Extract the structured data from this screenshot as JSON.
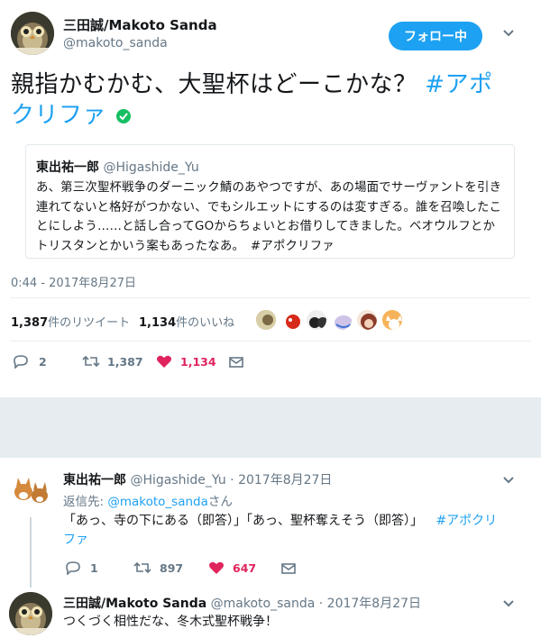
{
  "main_tweet": {
    "display_name": "三田誠/Makoto Sanda",
    "handle": "@makoto_sanda",
    "follow_label": "フォロー中",
    "text_line1": "親指かむかむ、大聖杯はどーこかな？",
    "hashtag_part1": "#アポ",
    "hashtag_part2": "クリファ",
    "quote": {
      "display_name": "東出祐一郎",
      "handle": "@Higashide_Yu",
      "lines": [
        "あ、第三次聖杯戦争のダーニック鯖のあやつですが、あの場面でサーヴァントを引き",
        "連れてないと格好がつかない、でもシルエットにするのは変すぎる。誰を召喚したこ",
        "とにしよう……と話し合ってGOからちょいとお借りしてきました。ベオウルフとか",
        "トリスタンとかいう案もあったなあ。　#アポクリファ"
      ]
    },
    "timestamp": "0:44 - 2017年8月27日",
    "retweets_count": "1,387",
    "retweets_label": "件のリツイート",
    "likes_count": "1,134",
    "likes_label": "件のいいね",
    "actions": {
      "replies": "2",
      "retweets": "1,387",
      "likes": "1,134"
    }
  },
  "reply1": {
    "display_name": "東出祐一郎",
    "handle": "@Higashide_Yu",
    "date": "· 2017年8月27日",
    "reply_to_prefix": "返信先: ",
    "reply_to_handle": "@makoto_sanda",
    "reply_to_suffix": "さん",
    "text_line1": "「あっ、寺の下にある（即答）」「あっ、聖杯奪えそう（即答）」",
    "hashtag_part1": "#アポクリ",
    "hashtag_part2": "ファ",
    "actions": {
      "replies": "1",
      "retweets": "897",
      "likes": "647"
    }
  },
  "reply2": {
    "display_name": "三田誠/Makoto Sanda",
    "handle": "@makoto_sanda",
    "date": "· 2017年8月27日",
    "text": "つくづく相性だな、冬木式聖杯戦争！"
  },
  "colors": {
    "accent": "#1da1f2",
    "like": "#e0245e",
    "verified": "#17bf63"
  }
}
